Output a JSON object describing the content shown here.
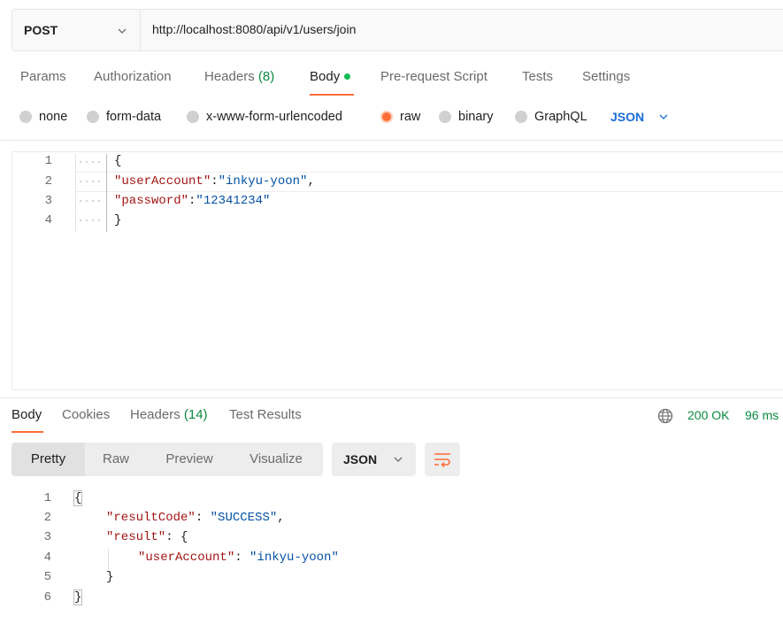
{
  "request": {
    "method": "POST",
    "url": "http://localhost:8080/api/v1/users/join"
  },
  "tabs": {
    "params": "Params",
    "authorization": "Authorization",
    "headers": "Headers",
    "headers_count": "(8)",
    "body": "Body",
    "prerequest": "Pre-request Script",
    "tests": "Tests",
    "settings": "Settings"
  },
  "body_types": {
    "none": "none",
    "form_data": "form-data",
    "urlencoded": "x-www-form-urlencoded",
    "raw": "raw",
    "binary": "binary",
    "graphql": "GraphQL",
    "format": "JSON",
    "selected": "raw"
  },
  "request_body": {
    "line_numbers": [
      "1",
      "2",
      "3",
      "4"
    ],
    "open_brace": "{",
    "close_brace": "}",
    "key1": "\"userAccount\"",
    "val1": "\"inkyu-yoon\"",
    "key2": "\"password\"",
    "val2": "\"12341234\""
  },
  "response_tabs": {
    "body": "Body",
    "cookies": "Cookies",
    "headers": "Headers",
    "headers_count": "(14)",
    "test_results": "Test Results"
  },
  "response_status": {
    "code": "200 OK",
    "time": "96 ms"
  },
  "response_view": {
    "pretty": "Pretty",
    "raw": "Raw",
    "preview": "Preview",
    "visualize": "Visualize",
    "format": "JSON"
  },
  "response_body": {
    "line_numbers": [
      "1",
      "2",
      "3",
      "4",
      "5",
      "6"
    ],
    "open_brace": "{",
    "close_brace": "}",
    "key_result_code": "\"resultCode\"",
    "val_result_code": "\"SUCCESS\"",
    "key_result": "\"result\"",
    "inner_open": "{",
    "key_user": "\"userAccount\"",
    "val_user": "\"inkyu-yoon\"",
    "inner_close": "}"
  },
  "colors": {
    "accent": "#ff6c37",
    "status_ok": "#0b8a3f",
    "link_blue": "#1a6dd6",
    "json_key": "#a31515",
    "json_string": "#0451a5"
  }
}
